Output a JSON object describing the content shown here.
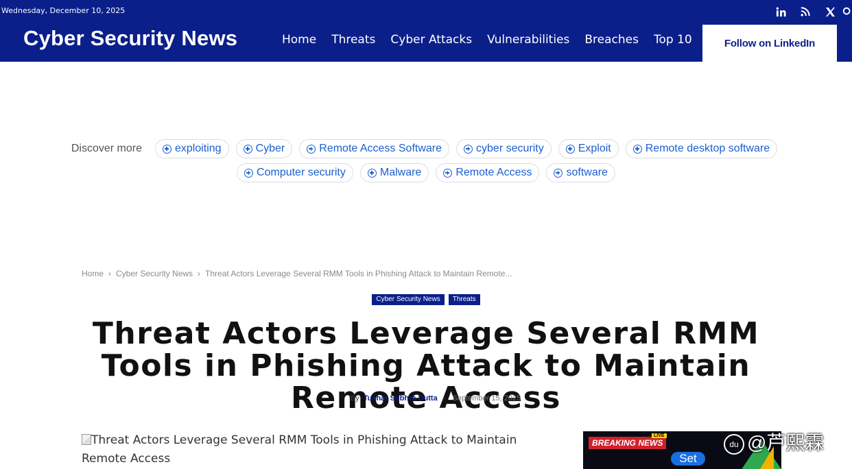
{
  "header": {
    "date": "Wednesday, December 10, 2025",
    "logo": "Cyber Security News",
    "nav": [
      "Home",
      "Threats",
      "Cyber Attacks",
      "Vulnerabilities",
      "Breaches",
      "Top 10"
    ],
    "follow_label": "Follow on LinkedIn",
    "social_icons": [
      "linkedin-icon",
      "rss-icon",
      "x-icon",
      "search-icon"
    ]
  },
  "discover": {
    "label": "Discover more",
    "row1": [
      "exploiting",
      "Cyber",
      "Remote Access Software",
      "cyber security",
      "Exploit",
      "Remote desktop software"
    ],
    "row2": [
      "Computer security",
      "Malware",
      "Remote Access",
      "software"
    ]
  },
  "breadcrumb": {
    "items": [
      "Home",
      "Cyber Security News",
      "Threat Actors Leverage Several RMM Tools in Phishing Attack to Maintain Remote..."
    ]
  },
  "categories": [
    "Cyber Security News",
    "Threats"
  ],
  "article": {
    "title": "Threat Actors Leverage Several RMM Tools in Phishing Attack to Maintain Remote Access",
    "by": "By",
    "author": "Tushar Subhra Dutta",
    "separator": "-",
    "date": "September 15, 2025",
    "image_alt": "Threat Actors Leverage Several RMM Tools in Phishing Attack to Maintain Remote Access"
  },
  "ad": {
    "breaking": "BREAKING NEWS",
    "live": "LIVE",
    "set": "Set"
  },
  "watermark": {
    "text": "@芦熙霖"
  },
  "colors": {
    "header_bg": "#0a1f8a",
    "chip_text": "#1a5fd0",
    "category_bg": "#0a1f8a"
  }
}
